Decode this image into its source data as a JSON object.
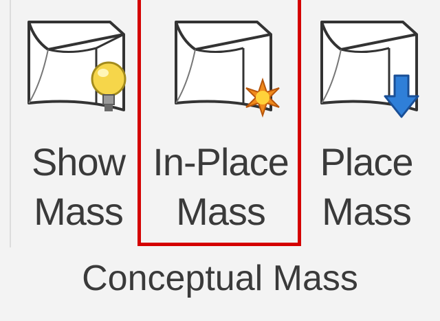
{
  "panel": {
    "title": "Conceptual Mass"
  },
  "buttons": [
    {
      "id": "show-mass",
      "line1": "Show",
      "line2": "Mass",
      "icon": "mass-lightbulb-icon"
    },
    {
      "id": "in-place-mass",
      "line1": "In-Place",
      "line2": "Mass",
      "icon": "mass-sparkle-icon",
      "highlighted": true
    },
    {
      "id": "place-mass",
      "line1": "Place",
      "line2": "Mass",
      "icon": "mass-down-arrow-icon"
    }
  ],
  "colors": {
    "highlight_border": "#d40000",
    "text": "#3a3a3a",
    "background": "#f3f3f3",
    "bulb": "#f6d64a",
    "sparkle": "#f08a1c",
    "arrow": "#2f7fd8"
  }
}
